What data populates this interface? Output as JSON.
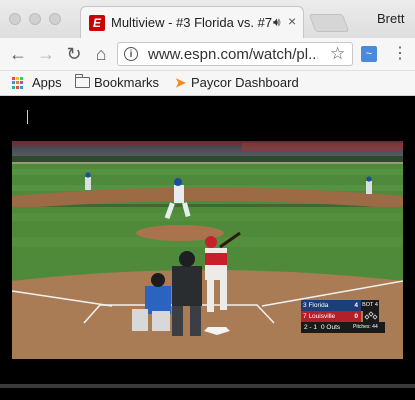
{
  "browser": {
    "tab": {
      "title": "Multiview - #3 Florida vs. #7",
      "audio_icon": "speaker-icon",
      "close_glyph": "×"
    },
    "profile_name": "Brett",
    "url": "www.espn.com/watch/pl...",
    "bookmarks": {
      "apps_label": "Apps",
      "bookmarks_label": "Bookmarks",
      "paycor_label": "Paycor Dashboard"
    }
  },
  "scorebug": {
    "team1": {
      "seed": "3",
      "name": "Florida",
      "score": "4"
    },
    "team2": {
      "seed": "7",
      "name": "Louisville",
      "score": "0"
    },
    "inning": "BOT 4",
    "count": "2 - 1",
    "outs": "0 Outs",
    "pitches": "Pitches: 44"
  },
  "colors": {
    "espn_red": "#cc0000",
    "florida_blue": "#1c3d7a",
    "louisville_red": "#b3202a"
  }
}
